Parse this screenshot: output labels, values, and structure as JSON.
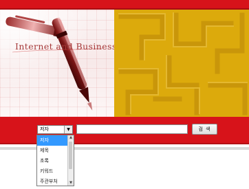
{
  "banner": {
    "text": "Internet and Business",
    "gold_color": "#dcaa0c",
    "red_color": "#d7131a"
  },
  "search": {
    "field_select": {
      "selected": "저자",
      "arrow_icon": "chevron-down-icon"
    },
    "input_value": "",
    "button_label": "검 색",
    "dropdown_options": [
      "저자",
      "제목",
      "초록",
      "키워드",
      "주관부처"
    ]
  }
}
